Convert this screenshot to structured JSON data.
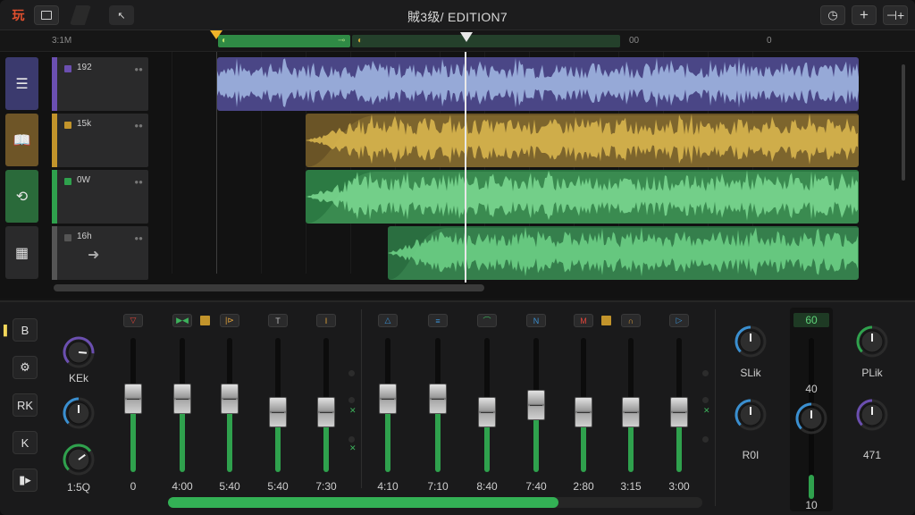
{
  "titlebar": {
    "logo_text": "玩",
    "title": "賊3级/ EDITION7"
  },
  "ruler": {
    "left_label": "3:1M",
    "labels": [
      {
        "text": "00"
      },
      {
        "text": "0"
      }
    ]
  },
  "tracks": [
    {
      "name": "192",
      "color": "#6b4fb0",
      "icon_name": "menu-icon",
      "icon_bg": "#3b3a6e",
      "glyph": "☰"
    },
    {
      "name": "15k",
      "color": "#c2942b",
      "icon_name": "book-icon",
      "icon_bg": "#6e5527",
      "glyph": "📖"
    },
    {
      "name": "0W",
      "color": "#2fa14d",
      "icon_name": "loop-icon",
      "icon_bg": "#2a6a3a",
      "glyph": "⟲"
    },
    {
      "name": "16h",
      "color": "#555555",
      "icon_name": "grid-icon",
      "icon_bg": "#2a2a2b",
      "glyph": "▦"
    }
  ],
  "side_buttons": [
    "B",
    "⚙",
    "RK",
    "K",
    "▮▸"
  ],
  "left_knobs": [
    {
      "label": "KEk",
      "value": 0.85,
      "color": "#6b4fb0"
    },
    {
      "label": "",
      "value": 0.5,
      "color": "#3a8fd0"
    },
    {
      "label": "1:5Q",
      "value": 0.7,
      "color": "#2fa14d"
    }
  ],
  "channels": [
    {
      "btn": "▽",
      "btn_color": "#e0453a",
      "level": 0.55,
      "value": "0"
    },
    {
      "btn": "▶◀",
      "btn_color": "#3db25c",
      "level": 0.55,
      "value": "4:00",
      "square": true
    },
    {
      "btn": "|⊳",
      "btn_color": "#e2a23a",
      "level": 0.55,
      "value": "5:40"
    },
    {
      "btn": "T",
      "btn_color": "#bbbbbb",
      "level": 0.45,
      "value": "5:40"
    },
    {
      "btn": "I",
      "btn_color": "#e2a23a",
      "level": 0.45,
      "value": "7:30"
    },
    {
      "btn": "△",
      "btn_color": "#3a8fd0",
      "level": 0.55,
      "value": "4:10"
    },
    {
      "btn": "≡",
      "btn_color": "#3a8fd0",
      "level": 0.55,
      "value": "7:10"
    },
    {
      "btn": "⌒",
      "btn_color": "#3db25c",
      "level": 0.45,
      "value": "8:40"
    },
    {
      "btn": "N",
      "btn_color": "#3a8fd0",
      "level": 0.5,
      "value": "7:40"
    },
    {
      "btn": "M",
      "btn_color": "#e0453a",
      "level": 0.45,
      "value": "2:80",
      "square": true
    },
    {
      "btn": "∩",
      "btn_color": "#e2a23a",
      "level": 0.45,
      "value": "3:15"
    },
    {
      "btn": "▷",
      "btn_color": "#3a8fd0",
      "level": 0.45,
      "value": "3:00"
    }
  ],
  "bottom_bar_level": 0.73,
  "right_knobs": [
    {
      "label": "SLik",
      "value": 0.5,
      "color": "#3a8fd0"
    },
    {
      "label": "R0I",
      "value": 0.5,
      "color": "#3a8fd0"
    },
    {
      "label": "PLik",
      "value": 0.5,
      "color": "#2fa14d"
    },
    {
      "label": "471",
      "value": 0.5,
      "color": "#6b4fb0"
    }
  ],
  "master": {
    "top_value": "60",
    "mid_value": "40",
    "bottom_value": "10",
    "level": 0.15
  }
}
